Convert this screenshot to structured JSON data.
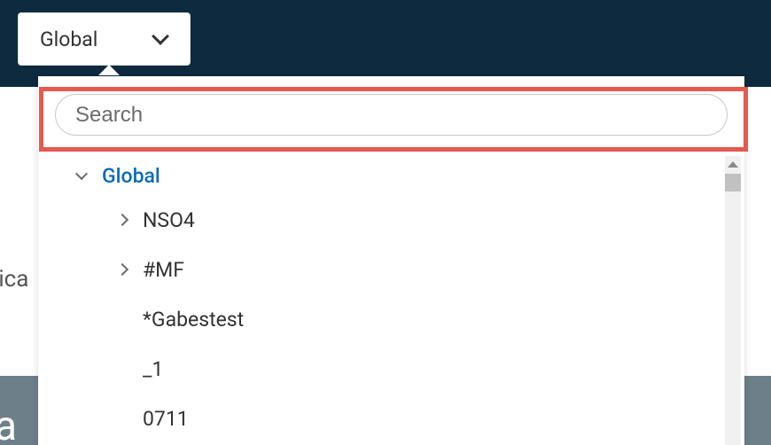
{
  "scope_selector": {
    "label": "Global"
  },
  "search": {
    "placeholder": "Search",
    "value": ""
  },
  "tree": {
    "root": {
      "label": "Global",
      "expanded": true
    },
    "children": [
      {
        "label": "NSO4",
        "has_children": true
      },
      {
        "label": "#MF",
        "has_children": true
      },
      {
        "label": "*Gabestest",
        "has_children": false
      },
      {
        "label": "_1",
        "has_children": false
      },
      {
        "label": "0711",
        "has_children": false
      }
    ]
  },
  "background": {
    "fragment_left": "lica",
    "fragment_footer": "a"
  }
}
